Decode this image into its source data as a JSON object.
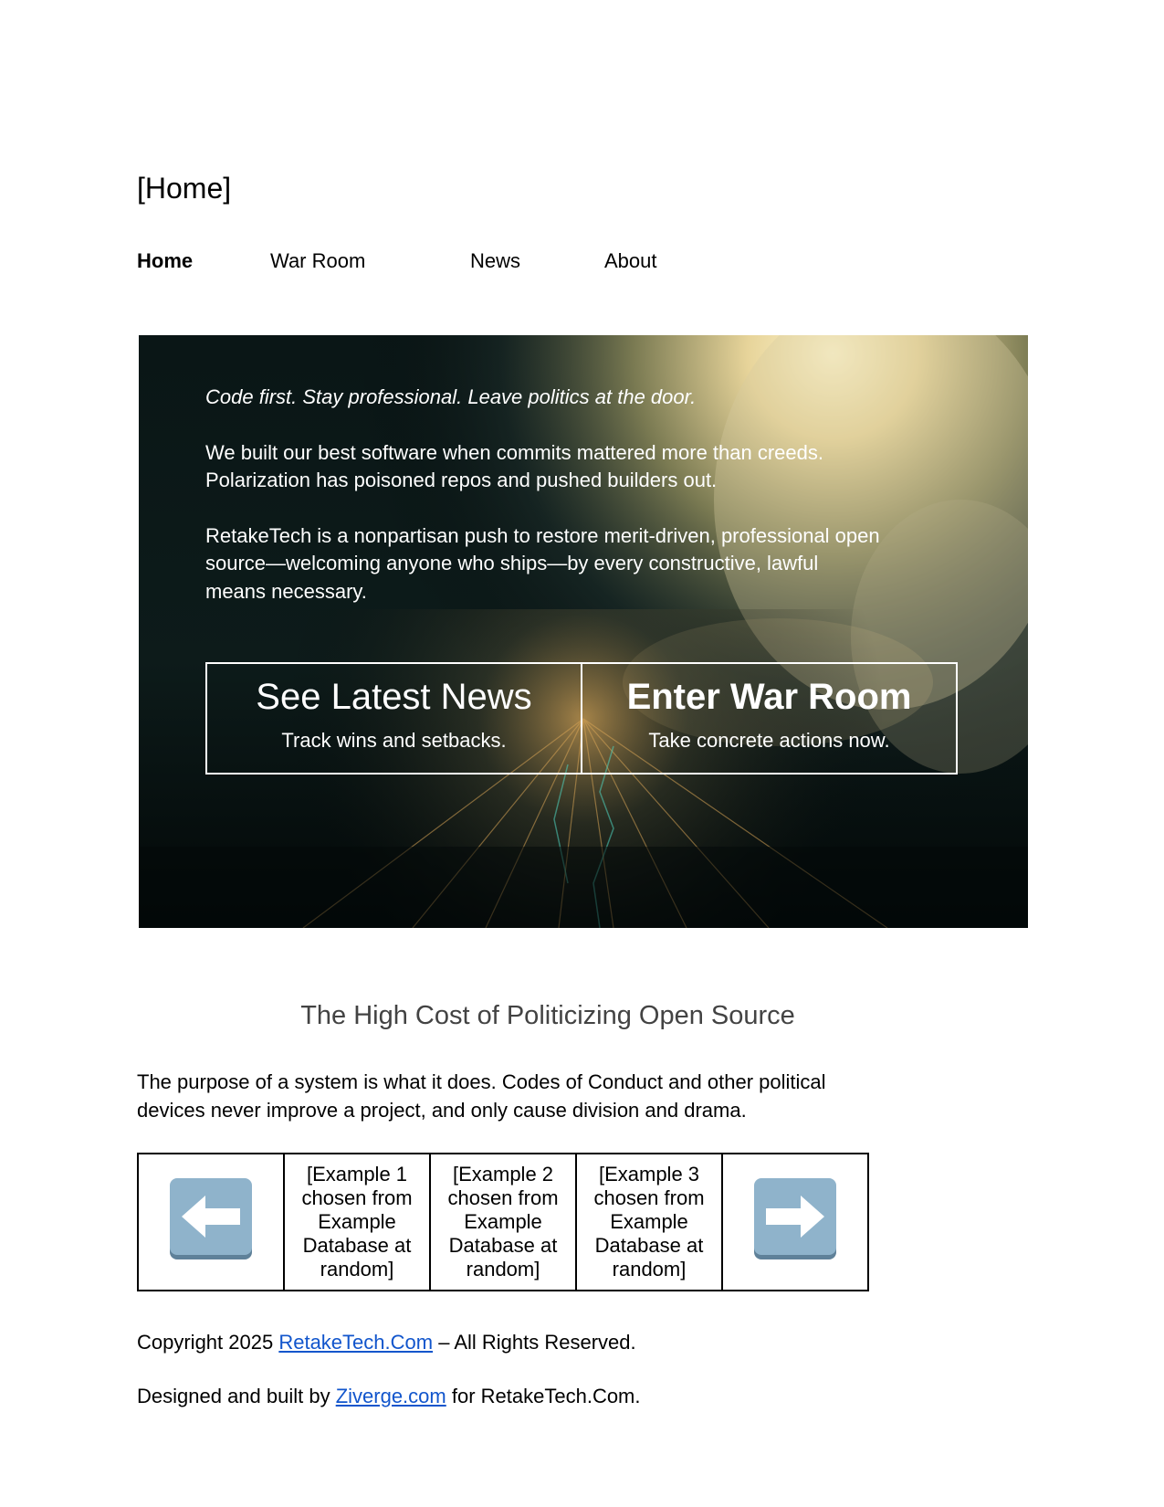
{
  "page": {
    "heading": "[Home]"
  },
  "nav": {
    "items": [
      {
        "label": "Home",
        "active": true
      },
      {
        "label": "War Room",
        "active": false
      },
      {
        "label": "News",
        "active": false
      },
      {
        "label": "About",
        "active": false
      }
    ]
  },
  "hero": {
    "tagline": "Code first. Stay professional. Leave politics at the door.",
    "paragraph1": "We built our best software when commits mattered more than creeds. Polarization has poisoned repos and pushed builders out.",
    "paragraph2": "RetakeTech is a nonpartisan push to restore merit-driven, professional open source—welcoming anyone who ships—by every constructive, lawful means necessary.",
    "cta_news": {
      "title": "See Latest News",
      "subtitle": "Track wins and setbacks."
    },
    "cta_war_room": {
      "title": "Enter War Room",
      "subtitle": "Take concrete actions now."
    }
  },
  "section": {
    "title": "The High Cost of Politicizing Open Source",
    "body": "The purpose of a system is what it does. Codes of Conduct and other political devices never improve a project, and only cause division and drama."
  },
  "examples": {
    "prev_icon": "left-arrow-icon",
    "next_icon": "right-arrow-icon",
    "cells": [
      "[Example 1 chosen from Example Database at random]",
      "[Example 2 chosen from Example Database at random]",
      "[Example 3 chosen from Example Database at random]"
    ]
  },
  "footer": {
    "copyright_prefix": "Copyright 2025 ",
    "copyright_link": "RetakeTech.Com",
    "copyright_suffix": " – All Rights Reserved.",
    "designed_prefix": "Designed and built by ",
    "designed_link": "Ziverge.com",
    "designed_suffix": " for RetakeTech.Com."
  },
  "colors": {
    "link": "#1155cc",
    "section_title": "#434343",
    "arrow_tile": "#8fb3cb"
  }
}
